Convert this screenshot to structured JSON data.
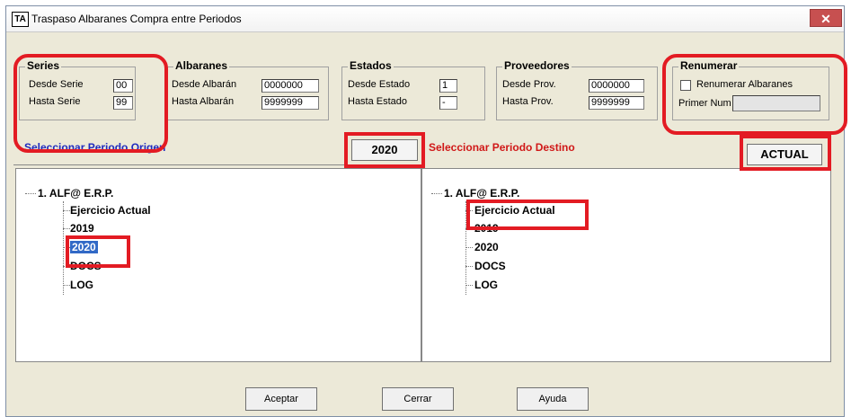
{
  "window": {
    "title": "Traspaso Albaranes Compra entre Periodos",
    "icon_text": "TA",
    "close_glyph": "✕"
  },
  "series": {
    "title": "Series",
    "desde_label": "Desde Serie",
    "desde_value": "00",
    "hasta_label": "Hasta Serie",
    "hasta_value": "99"
  },
  "albaranes": {
    "title": "Albaranes",
    "desde_label": "Desde Albarán",
    "desde_value": "0000000",
    "hasta_label": "Hasta Albarán",
    "hasta_value": "9999999"
  },
  "estados": {
    "title": "Estados",
    "desde_label": "Desde Estado",
    "desde_value": "1",
    "hasta_label": "Hasta Estado",
    "hasta_value": "-"
  },
  "proveedores": {
    "title": "Proveedores",
    "desde_label": "Desde Prov.",
    "desde_value": "0000000",
    "hasta_label": "Hasta Prov.",
    "hasta_value": "9999999"
  },
  "renumerar": {
    "title": "Renumerar",
    "checkbox_label": "Renumerar Albaranes",
    "checked": false,
    "primer_label": "Primer Num",
    "primer_value": ""
  },
  "origen": {
    "header": "Seleccionar Periodo Origen",
    "header_color": "#1f2bbf",
    "badge": "2020",
    "root": "1. ALF@ E.R.P.",
    "items": [
      "Ejercicio Actual",
      "2019",
      "2020",
      "DOCS",
      "LOG"
    ],
    "selected": "2020"
  },
  "destino": {
    "header": "Seleccionar Periodo Destino",
    "header_color": "#d01818",
    "badge": "ACTUAL",
    "root": "1. ALF@ E.R.P.",
    "items": [
      "Ejercicio Actual",
      "2019",
      "2020",
      "DOCS",
      "LOG"
    ],
    "selected": "Ejercicio Actual"
  },
  "buttons": {
    "aceptar": "Aceptar",
    "cerrar": "Cerrar",
    "ayuda": "Ayuda"
  },
  "colors": {
    "highlight": "#e31b23",
    "selection": "#3169c6"
  }
}
